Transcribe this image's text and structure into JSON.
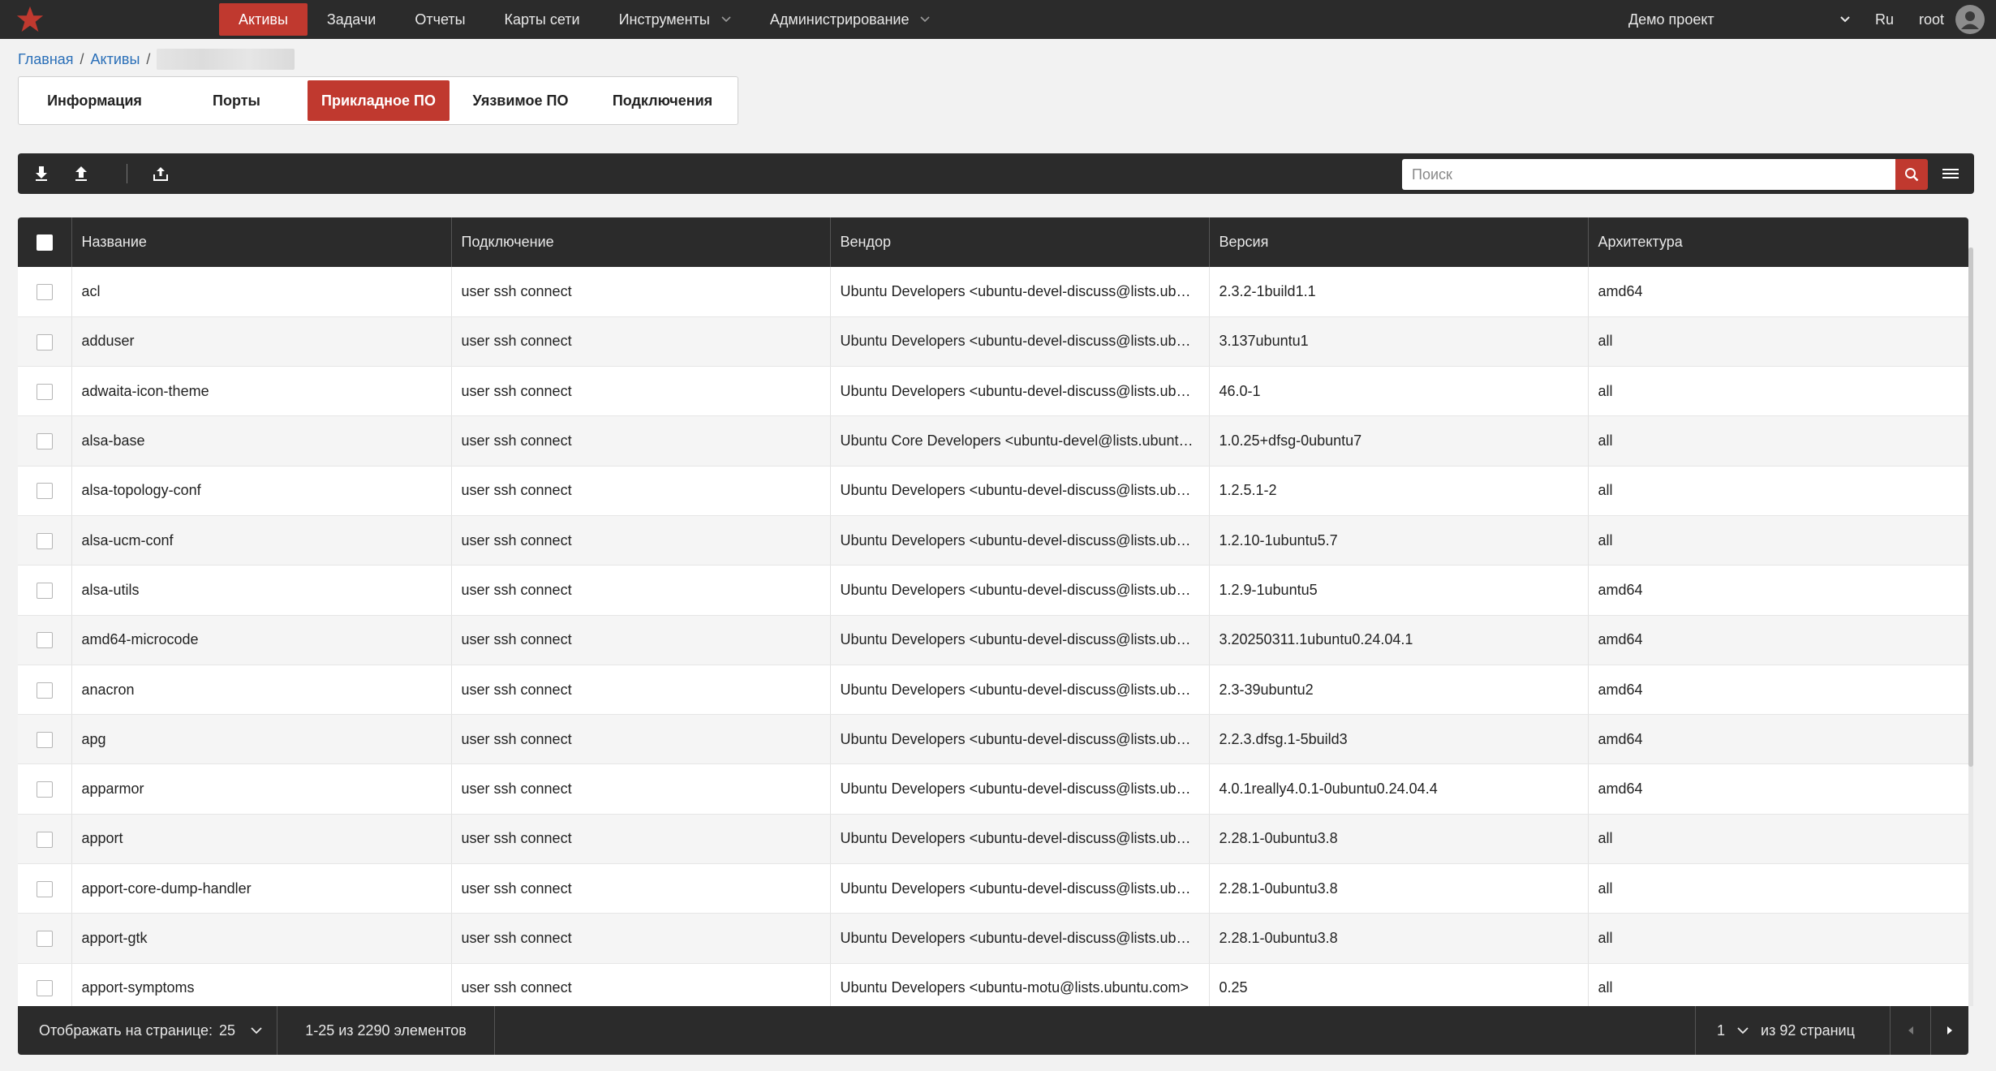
{
  "colors": {
    "accent": "#c0392f",
    "header_bg": "#2b2b2b",
    "link": "#2a6fb8"
  },
  "nav": {
    "items": [
      {
        "label": "Активы",
        "active": true
      },
      {
        "label": "Задачи"
      },
      {
        "label": "Отчеты"
      },
      {
        "label": "Карты сети"
      },
      {
        "label": "Инструменты",
        "dropdown": true
      },
      {
        "label": "Администрирование",
        "dropdown": true
      }
    ],
    "project": "Демо проект",
    "language": "Ru",
    "user": "root"
  },
  "breadcrumb": {
    "home": "Главная",
    "assets": "Активы"
  },
  "tabs": [
    {
      "label": "Информация"
    },
    {
      "label": "Порты"
    },
    {
      "label": "Прикладное ПО",
      "active": true
    },
    {
      "label": "Уязвимое ПО"
    },
    {
      "label": "Подключения"
    }
  ],
  "toolbar": {
    "icons": [
      "download-icon",
      "upload-icon",
      "export-icon",
      "menu-icon"
    ],
    "search_placeholder": "Поиск"
  },
  "table": {
    "columns": [
      "Название",
      "Подключение",
      "Вендор",
      "Версия",
      "Архитектура"
    ],
    "rows": [
      {
        "name": "acl",
        "connection": "user ssh connect",
        "vendor": "Ubuntu Developers <ubuntu-devel-discuss@lists.ubuntu.com>",
        "version": "2.3.2-1build1.1",
        "arch": "amd64"
      },
      {
        "name": "adduser",
        "connection": "user ssh connect",
        "vendor": "Ubuntu Developers <ubuntu-devel-discuss@lists.ubuntu.com>",
        "version": "3.137ubuntu1",
        "arch": "all"
      },
      {
        "name": "adwaita-icon-theme",
        "connection": "user ssh connect",
        "vendor": "Ubuntu Developers <ubuntu-devel-discuss@lists.ubuntu.com>",
        "version": "46.0-1",
        "arch": "all"
      },
      {
        "name": "alsa-base",
        "connection": "user ssh connect",
        "vendor": "Ubuntu Core Developers <ubuntu-devel@lists.ubuntu.com>",
        "version": "1.0.25+dfsg-0ubuntu7",
        "arch": "all"
      },
      {
        "name": "alsa-topology-conf",
        "connection": "user ssh connect",
        "vendor": "Ubuntu Developers <ubuntu-devel-discuss@lists.ubuntu.com>",
        "version": "1.2.5.1-2",
        "arch": "all"
      },
      {
        "name": "alsa-ucm-conf",
        "connection": "user ssh connect",
        "vendor": "Ubuntu Developers <ubuntu-devel-discuss@lists.ubuntu.com>",
        "version": "1.2.10-1ubuntu5.7",
        "arch": "all"
      },
      {
        "name": "alsa-utils",
        "connection": "user ssh connect",
        "vendor": "Ubuntu Developers <ubuntu-devel-discuss@lists.ubuntu.com>",
        "version": "1.2.9-1ubuntu5",
        "arch": "amd64"
      },
      {
        "name": "amd64-microcode",
        "connection": "user ssh connect",
        "vendor": "Ubuntu Developers <ubuntu-devel-discuss@lists.ubuntu.com>",
        "version": "3.20250311.1ubuntu0.24.04.1",
        "arch": "amd64"
      },
      {
        "name": "anacron",
        "connection": "user ssh connect",
        "vendor": "Ubuntu Developers <ubuntu-devel-discuss@lists.ubuntu.com>",
        "version": "2.3-39ubuntu2",
        "arch": "amd64"
      },
      {
        "name": "apg",
        "connection": "user ssh connect",
        "vendor": "Ubuntu Developers <ubuntu-devel-discuss@lists.ubuntu.com>",
        "version": "2.2.3.dfsg.1-5build3",
        "arch": "amd64"
      },
      {
        "name": "apparmor",
        "connection": "user ssh connect",
        "vendor": "Ubuntu Developers <ubuntu-devel-discuss@lists.ubuntu.com>",
        "version": "4.0.1really4.0.1-0ubuntu0.24.04.4",
        "arch": "amd64"
      },
      {
        "name": "apport",
        "connection": "user ssh connect",
        "vendor": "Ubuntu Developers <ubuntu-devel-discuss@lists.ubuntu.com>",
        "version": "2.28.1-0ubuntu3.8",
        "arch": "all"
      },
      {
        "name": "apport-core-dump-handler",
        "connection": "user ssh connect",
        "vendor": "Ubuntu Developers <ubuntu-devel-discuss@lists.ubuntu.com>",
        "version": "2.28.1-0ubuntu3.8",
        "arch": "all"
      },
      {
        "name": "apport-gtk",
        "connection": "user ssh connect",
        "vendor": "Ubuntu Developers <ubuntu-devel-discuss@lists.ubuntu.com>",
        "version": "2.28.1-0ubuntu3.8",
        "arch": "all"
      },
      {
        "name": "apport-symptoms",
        "connection": "user ssh connect",
        "vendor": "Ubuntu Developers <ubuntu-motu@lists.ubuntu.com>",
        "version": "0.25",
        "arch": "all"
      }
    ]
  },
  "footer": {
    "per_page_label": "Отображать на странице:",
    "per_page_value": "25",
    "range": "1-25 из 2290 элементов",
    "page": "1",
    "page_of": "из 92 страниц"
  }
}
